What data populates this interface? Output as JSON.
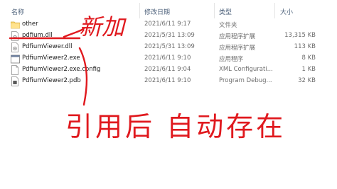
{
  "columns": {
    "name": "名称",
    "date": "修改日期",
    "type": "类型",
    "size": "大小"
  },
  "files": [
    {
      "name": "other",
      "date": "2021/6/11 9:17",
      "type": "文件夹",
      "size": "",
      "icon": "folder-icon"
    },
    {
      "name": "pdfium.dll",
      "date": "2021/5/31 13:09",
      "type": "应用程序扩展",
      "size": "13,315 KB",
      "icon": "dll-file-icon"
    },
    {
      "name": "PdfiumViewer.dll",
      "date": "2021/5/31 13:09",
      "type": "应用程序扩展",
      "size": "113 KB",
      "icon": "dll-file-icon"
    },
    {
      "name": "PdfiumViewer2.exe",
      "date": "2021/6/11 9:10",
      "type": "应用程序",
      "size": "8 KB",
      "icon": "exe-file-icon"
    },
    {
      "name": "PdfiumViewer2.exe.config",
      "date": "2021/6/11 9:04",
      "type": "XML Configurati...",
      "size": "1 KB",
      "icon": "config-file-icon"
    },
    {
      "name": "PdfiumViewer2.pdb",
      "date": "2021/6/11 9:10",
      "type": "Program Debug...",
      "size": "32 KB",
      "icon": "pdb-file-icon"
    }
  ],
  "annotations": {
    "note_new": "新加",
    "note_bottom": "引用后 自动存在",
    "ink_color": "#e0191e"
  }
}
